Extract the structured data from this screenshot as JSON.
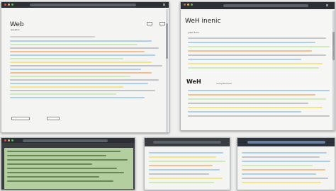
{
  "screens": {
    "w1": {
      "heading": "Web",
      "subheading": "question"
    },
    "w2": {
      "heading": "WeH inenic",
      "subheading": "jnilirt fuclo",
      "section": "WeH",
      "section_caption": "uuriil Thuriruin"
    }
  },
  "colors": {
    "titlebar": "#2c2f33",
    "page_bg": "#f4f4f2",
    "dark_page": "#3a3d40",
    "highlight_green": "#c9e8b0",
    "highlight_blue": "#9fc8ef",
    "highlight_orange": "#f2b57d",
    "highlight_yellow": "#f3e07a",
    "text_gray": "#9a9da2"
  },
  "icons": {
    "window_controls": "traffic-light-dots",
    "address_bar": "url-bar",
    "menu": "hamburger-icon"
  }
}
